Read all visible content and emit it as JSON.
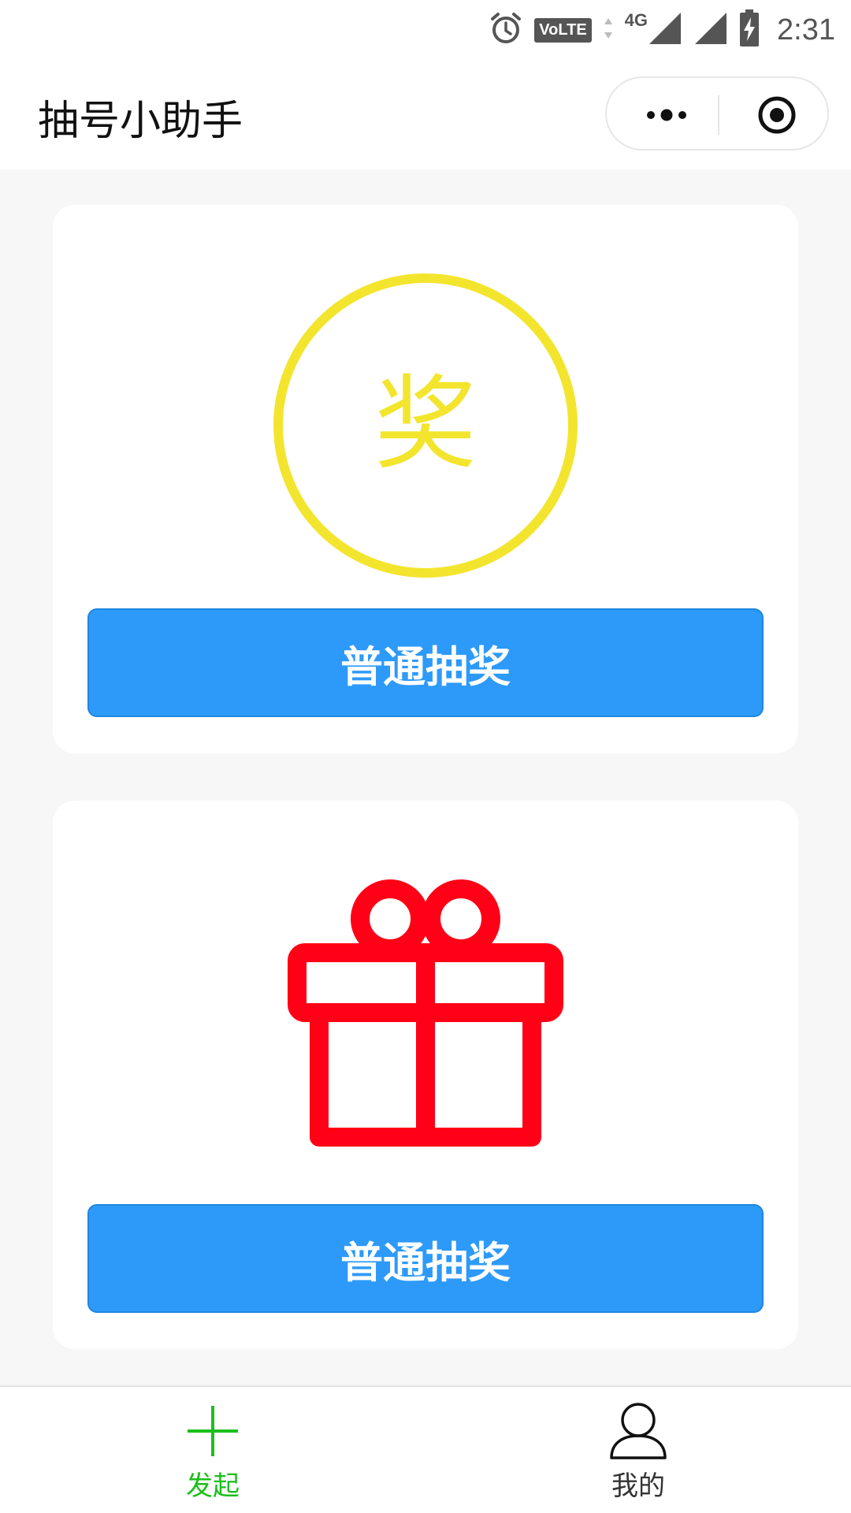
{
  "status_bar": {
    "time": "2:31",
    "volte_label": "VoLTE",
    "network_label": "4G",
    "icons": [
      "alarm-icon",
      "volte-icon",
      "data-arrows-icon",
      "signal-icon",
      "signal-icon",
      "battery-charging-icon"
    ]
  },
  "nav": {
    "title": "抽号小助手",
    "more_icon": "more-dots-icon",
    "close_icon": "target-close-icon"
  },
  "cards": [
    {
      "icon": "award-circle-icon",
      "icon_text": "奖",
      "icon_color": "#f3e52e",
      "button_label": "普通抽奖"
    },
    {
      "icon": "gift-icon",
      "icon_color": "#ff0016",
      "button_label": "普通抽奖"
    }
  ],
  "tabs": [
    {
      "label": "发起",
      "icon": "plus-icon",
      "active": true,
      "color": "#1bbf1b"
    },
    {
      "label": "我的",
      "icon": "user-icon",
      "active": false,
      "color": "#333333"
    }
  ],
  "colors": {
    "primary_button": "#2d9af9",
    "page_background": "#f7f7f7",
    "active_tab": "#1bbf1b"
  }
}
